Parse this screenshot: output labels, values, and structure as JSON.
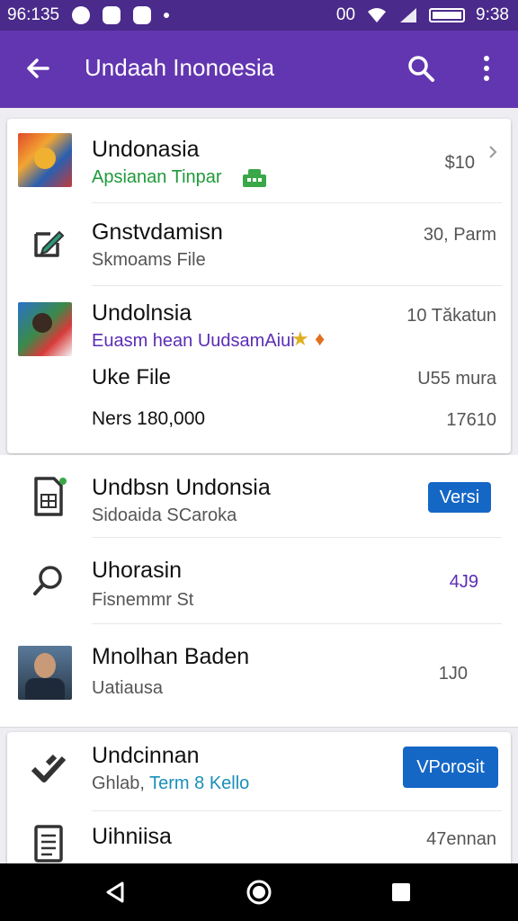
{
  "status_bar": {
    "time_left": "96:135",
    "signal_text": "00",
    "time_right": "9:38"
  },
  "app_bar": {
    "title": "Undaah Inonoesia"
  },
  "card1": {
    "rows": [
      {
        "title": "Undonasia",
        "subtitle": "Apsianan Tinpar",
        "right": "$10"
      },
      {
        "title": "Gnstvdamisn",
        "subtitle": "Skmoams File",
        "right": "30, Parm"
      },
      {
        "title": "Undolnsia",
        "subtitle": "Euasm hean UudsamAiui",
        "right": "10 Tăkatun"
      },
      {
        "title": "Uke File",
        "right": "U55 mura"
      },
      {
        "title": "Ners 180,000",
        "right": "17610"
      }
    ]
  },
  "list": {
    "rows": [
      {
        "title": "Undbsn Undonsia",
        "subtitle": "Sidoaida SCaroka",
        "button": "Versi"
      },
      {
        "title": "Uhorasin",
        "subtitle": "Fisnemmr St",
        "right": "4J9"
      },
      {
        "title": "Mnolhan Baden",
        "subtitle": "Uatiausa",
        "right": "1J0"
      }
    ]
  },
  "card2": {
    "rows": [
      {
        "title": "Undcinnan",
        "subtitle_a": "Ghlab,",
        "subtitle_b": "Term 8 Kello",
        "button": "VPorosit"
      },
      {
        "title": "Uihniisa",
        "right": "47ennan"
      }
    ]
  },
  "colors": {
    "status_bar": "#4a2a8a",
    "app_bar": "#6236b0",
    "accent_blue": "#1567c6",
    "green_text": "#1f9a3a",
    "purple_text": "#5b2db5",
    "teal_text": "#1a8fb8"
  },
  "icons": [
    "back-arrow-icon",
    "search-icon",
    "more-vert-icon",
    "edit-box-icon",
    "sheet-file-icon",
    "magnifier-icon",
    "check-stack-icon",
    "document-icon",
    "nav-back-icon",
    "nav-home-icon",
    "nav-recents-icon"
  ]
}
